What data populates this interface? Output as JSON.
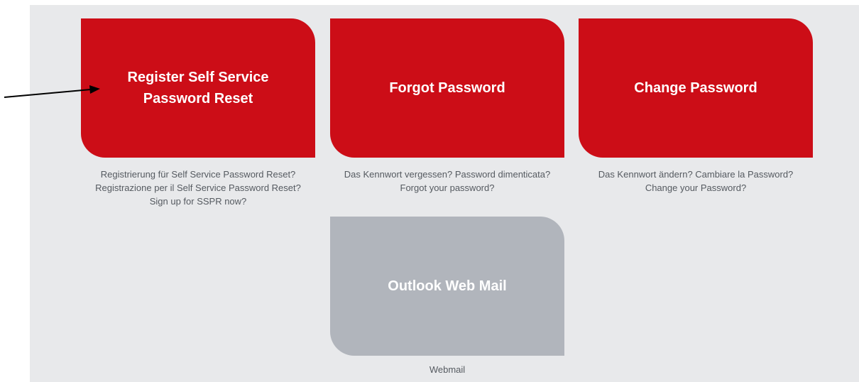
{
  "tiles": [
    {
      "label": "Register Self Service Password Reset",
      "description": [
        "Registrierung für Self Service Password Reset?",
        "Registrazione per il Self Service Password Reset?",
        "Sign up for SSPR now?"
      ]
    },
    {
      "label": "Forgot Password",
      "description": [
        "Das Kennwort vergessen? Password dimenticata?",
        "Forgot your password?"
      ]
    },
    {
      "label": "Change Password",
      "description": [
        "Das Kennwort ändern? Cambiare la Password?",
        "Change your Password?"
      ]
    },
    {
      "label": "Outlook Web Mail",
      "description": [
        "Webmail"
      ]
    }
  ],
  "colors": {
    "primary_tile": "#cc0d17",
    "secondary_tile": "#b1b5bc",
    "panel_background": "#e8e9eb"
  }
}
